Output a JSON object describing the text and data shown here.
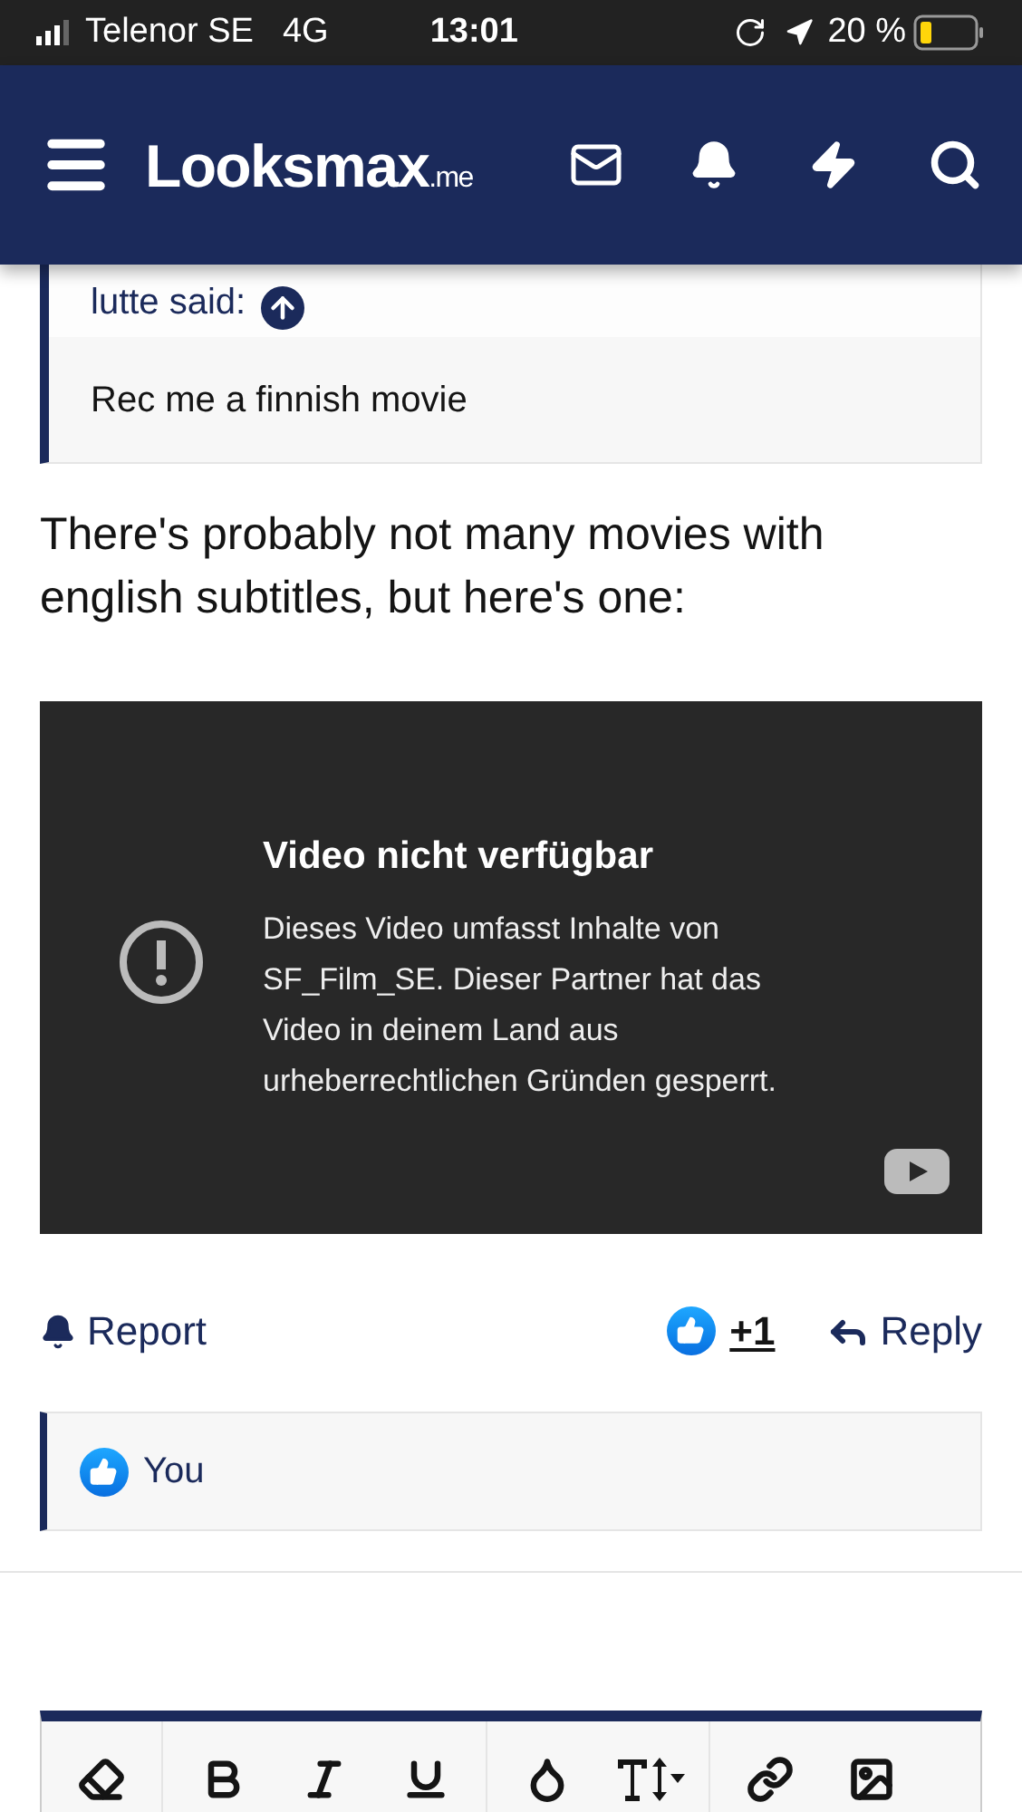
{
  "status_bar": {
    "carrier": "Telenor SE",
    "network": "4G",
    "time": "13:01",
    "battery": "20 %"
  },
  "header": {
    "logo": "Looksmax",
    "logo_suffix": ".me"
  },
  "quote": {
    "author": "lutte said:",
    "text": "Rec me a finnish movie"
  },
  "post": {
    "text": "There's probably not many movies with english subtitles, but here's one:"
  },
  "video": {
    "title": "Video nicht verfügbar",
    "message": "Dieses Video umfasst Inhalte von SF_Film_SE. Dieser Partner hat das Video in deinem Land aus urheberrechtlichen Gründen gesperrt."
  },
  "actions": {
    "report": "Report",
    "reaction_count": "+1",
    "reply": "Reply"
  },
  "reactions": {
    "users": "You"
  }
}
